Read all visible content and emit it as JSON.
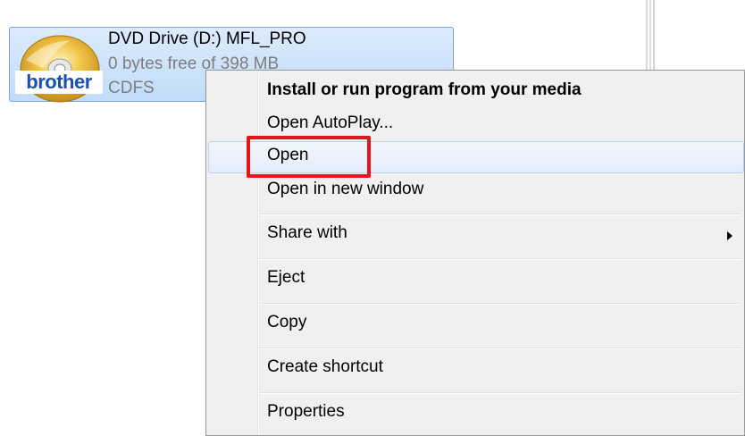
{
  "drive": {
    "name": "DVD Drive (D:) MFL_PRO",
    "free_space": "0 bytes free of 398 MB",
    "file_system": "CDFS",
    "logo_text": "brother",
    "icon": "dvd-disc-icon"
  },
  "context_menu": {
    "items": [
      {
        "label": "Install or run program from your media",
        "bold": true
      },
      {
        "label": "Open AutoPlay..."
      },
      {
        "label": "Open",
        "hovered": true,
        "highlighted": true
      },
      {
        "label": "Open in new window"
      },
      {
        "label": "Share with",
        "submenu": true
      },
      {
        "label": "Eject"
      },
      {
        "label": "Copy"
      },
      {
        "label": "Create shortcut"
      },
      {
        "label": "Properties"
      }
    ]
  },
  "colors": {
    "tile_background": "#c9e0fb",
    "tile_border": "#7da2ce",
    "menu_background": "#f0f0f0",
    "highlight_box": "#e8141b",
    "logo_blue": "#1c4fb4"
  }
}
